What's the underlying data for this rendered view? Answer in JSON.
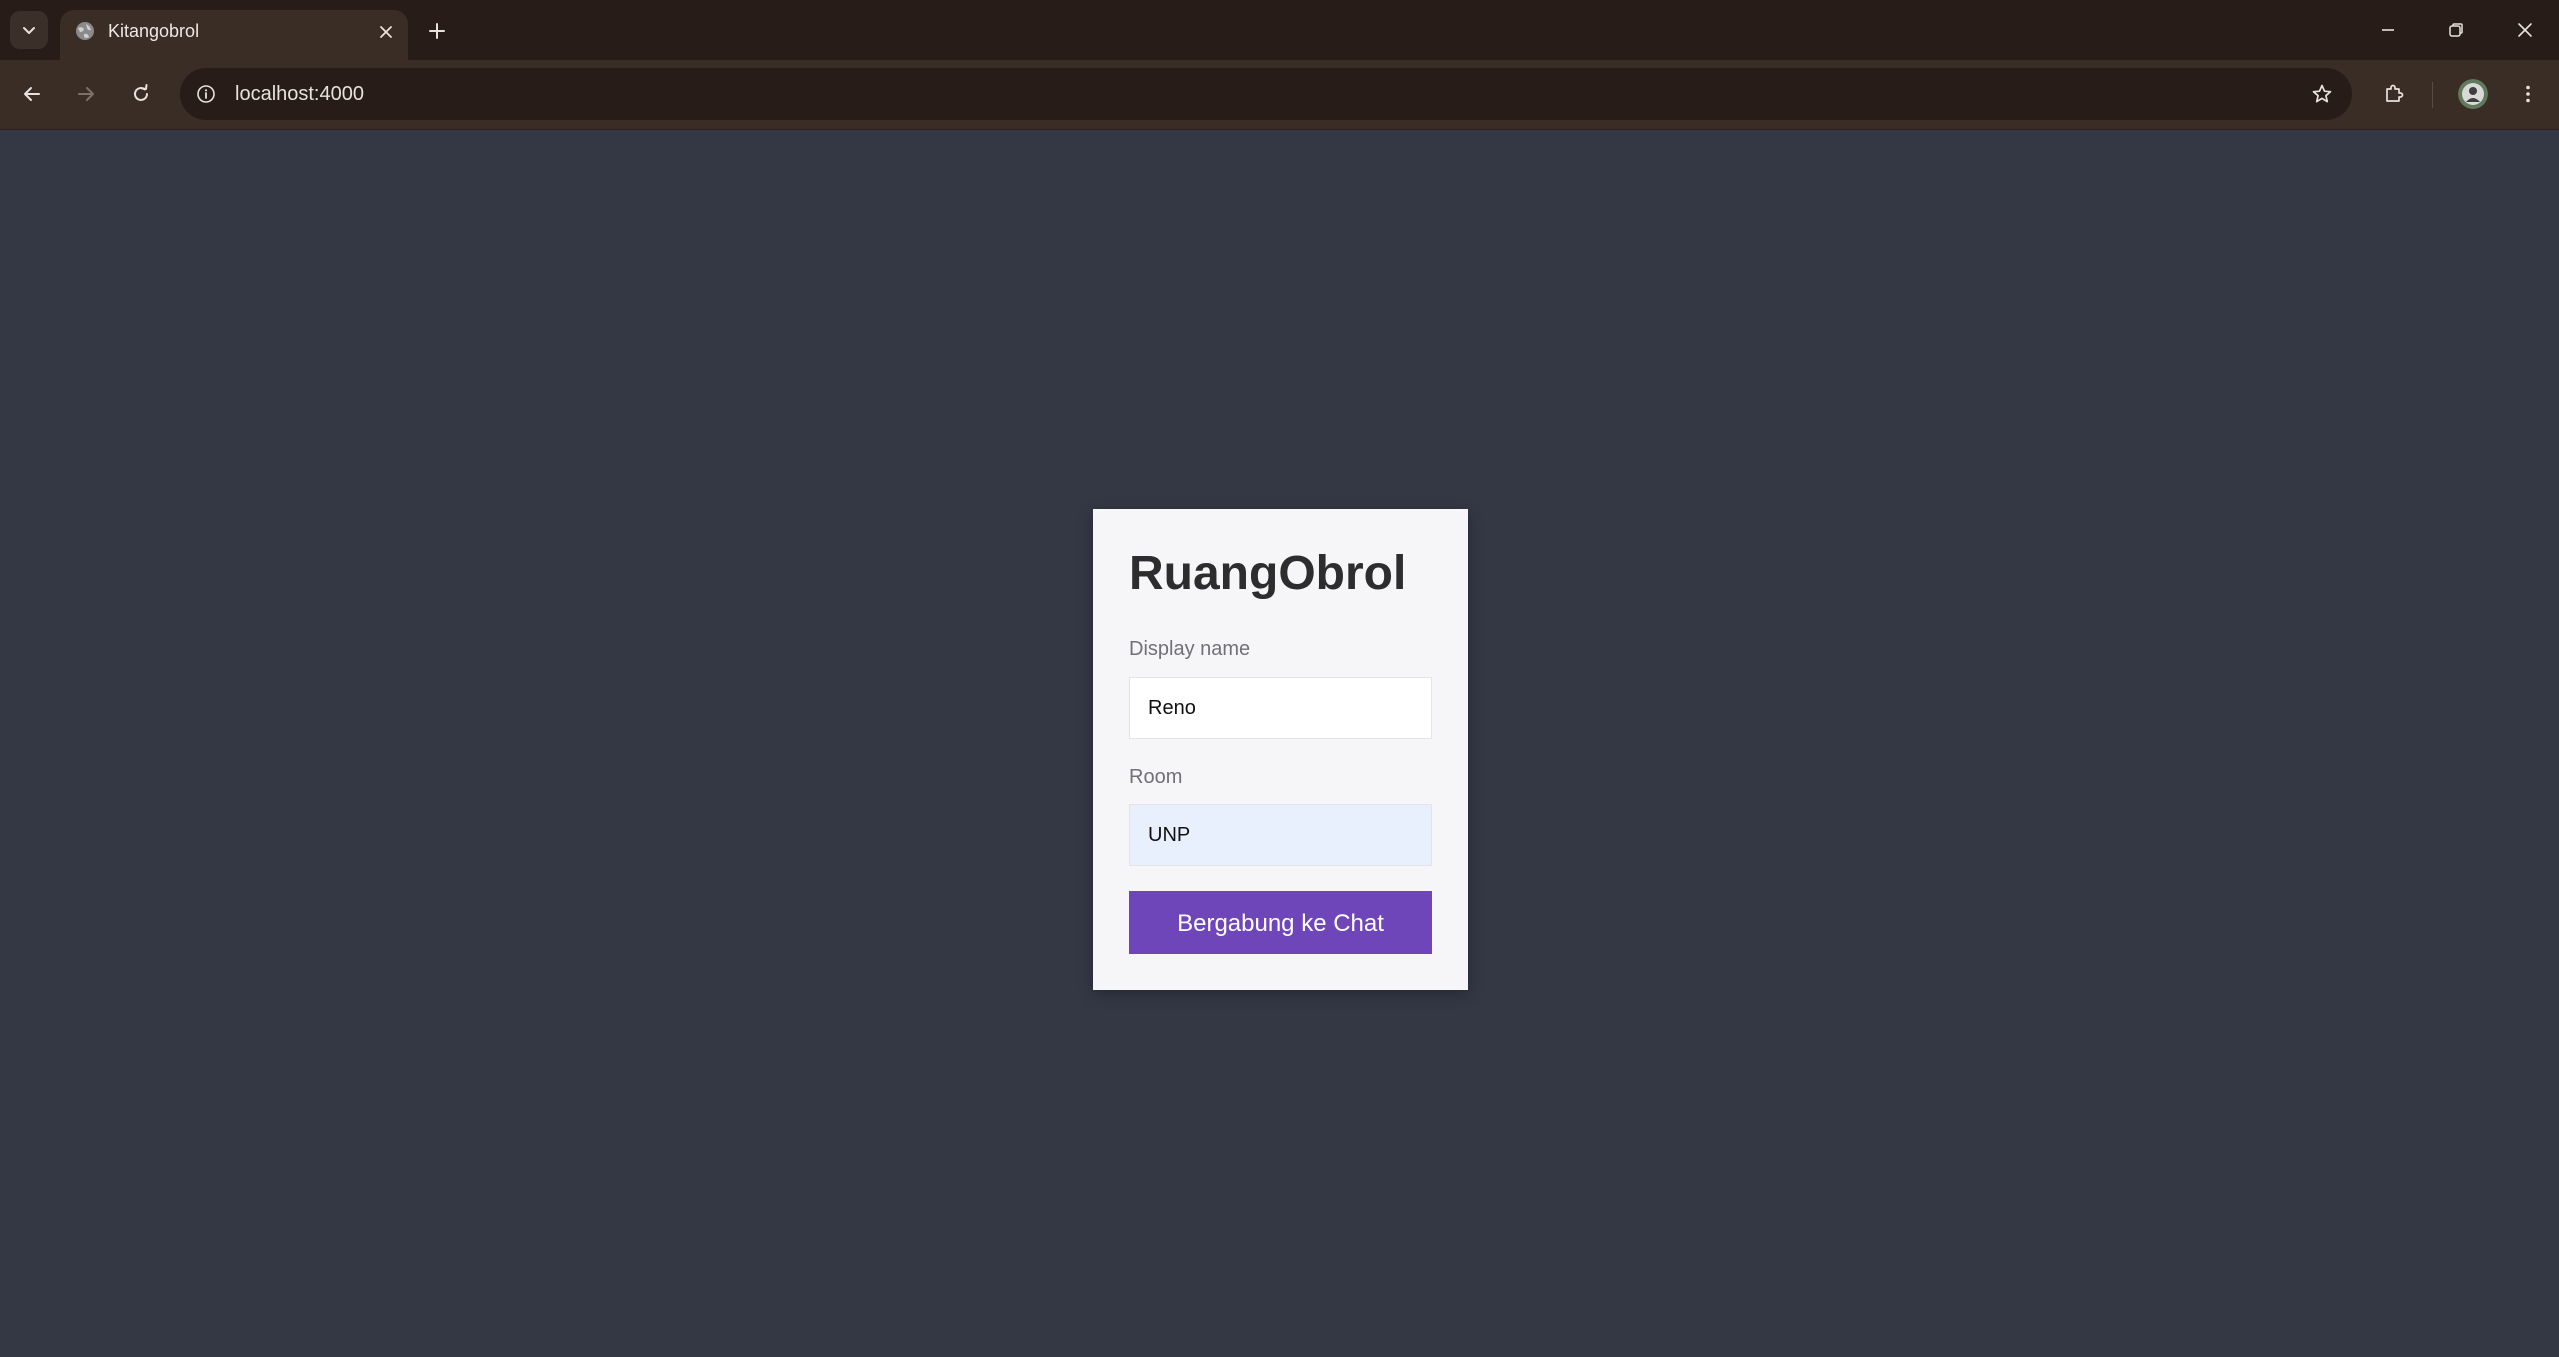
{
  "browser": {
    "tab": {
      "title": "Kitangobrol",
      "favicon": "globe-icon"
    },
    "address_bar": {
      "url": "localhost:4000"
    },
    "icons": {
      "tab_search": "chevron-down-icon",
      "tab_close": "close-icon",
      "new_tab": "plus-icon",
      "minimize": "minimize-icon",
      "restore": "restore-icon",
      "close_window": "close-icon",
      "back": "arrow-left-icon",
      "forward": "arrow-right-icon",
      "reload": "reload-icon",
      "site_info": "info-icon",
      "bookmark": "star-icon",
      "extensions": "puzzle-icon",
      "profile": "avatar",
      "menu": "kebab-menu-icon"
    },
    "colors": {
      "tabbar": "#271c17",
      "toolbar": "#3a2d25"
    }
  },
  "page": {
    "background": "#343845",
    "login_card": {
      "title": "RuangObrol",
      "display_name_label": "Display name",
      "display_name_value": "Reno",
      "room_label": "Room",
      "room_value": "UNP",
      "join_button_label": "Bergabung ke Chat",
      "button_color": "#6f46b9",
      "autofill_color": "#e8effd"
    }
  }
}
